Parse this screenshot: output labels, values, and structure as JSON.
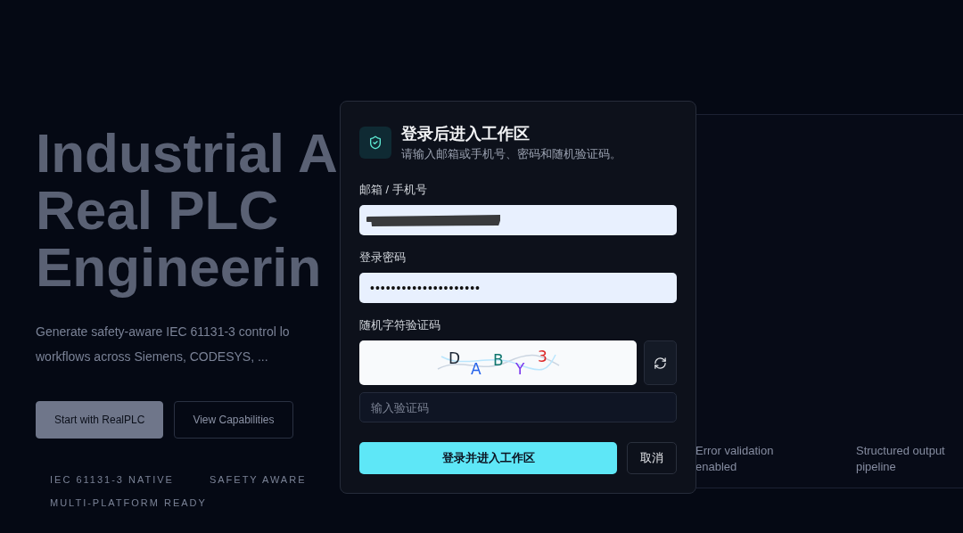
{
  "background": {
    "heading_lines": [
      "Industrial A",
      "Real PLC",
      "Engineerin"
    ],
    "description_lines": [
      "Generate safety-aware IEC 61131-3 control lo",
      "workflows across Siemens, CODESYS, ..."
    ],
    "buttons": [
      {
        "label": "Start with RealPLC",
        "kind": "primary"
      },
      {
        "label": "View Capabilities",
        "kind": "outline"
      }
    ],
    "tags": [
      "IEC 61131-3 NATIVE",
      "SAFETY AWARE",
      "MULTI-PLATFORM READY"
    ],
    "cards": [
      "Error validation enabled",
      "Structured output pipeline"
    ]
  },
  "dialog": {
    "title": "登录后进入工作区",
    "subtitle": "请输入邮箱或手机号、密码和随机验证码。",
    "fields": [
      {
        "kind": "redacted",
        "label": "邮箱 / 手机号"
      },
      {
        "kind": "password",
        "label": "登录密码",
        "value": "•••••••••••••••••••••"
      },
      {
        "kind": "captcha",
        "label": "随机字符验证码",
        "placeholder": "输入验证码",
        "captcha": [
          {
            "char": "D",
            "color": "#1f2937"
          },
          {
            "char": "A",
            "color": "#2563eb"
          },
          {
            "char": "B",
            "color": "#0f766e"
          },
          {
            "char": "Y",
            "color": "#7c3aed"
          },
          {
            "char": "3",
            "color": "#dc2626"
          }
        ]
      }
    ],
    "submit": "登录并进入工作区",
    "cancel": "取消"
  }
}
